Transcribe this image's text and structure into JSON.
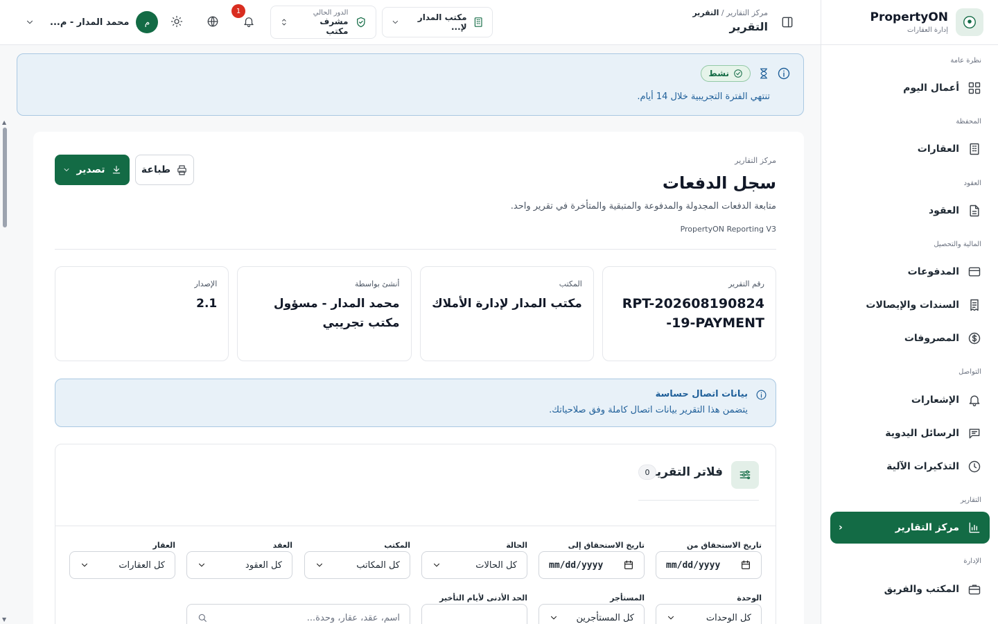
{
  "brand": {
    "name": "PropertyON",
    "subtitle": "إدارة العقارات"
  },
  "sidebar": {
    "sections": [
      {
        "title": "نظرة عامة",
        "items": [
          {
            "label": "أعمال اليوم",
            "icon": "grid-icon"
          }
        ]
      },
      {
        "title": "المحفظة",
        "items": [
          {
            "label": "العقارات",
            "icon": "building-icon"
          }
        ]
      },
      {
        "title": "العقود",
        "items": [
          {
            "label": "العقود",
            "icon": "file-icon"
          }
        ]
      },
      {
        "title": "المالية والتحصيل",
        "items": [
          {
            "label": "المدفوعات",
            "icon": "card-icon"
          },
          {
            "label": "السندات والإيصالات",
            "icon": "receipt-icon"
          },
          {
            "label": "المصروفات",
            "icon": "dollar-icon"
          }
        ]
      },
      {
        "title": "التواصل",
        "items": [
          {
            "label": "الإشعارات",
            "icon": "bell-icon"
          },
          {
            "label": "الرسائل اليدوية",
            "icon": "message-icon"
          },
          {
            "label": "التذكيرات الآلية",
            "icon": "clock-icon"
          }
        ]
      },
      {
        "title": "التقارير",
        "items": [
          {
            "label": "مركز التقارير",
            "icon": "chart-icon",
            "active": true
          }
        ]
      },
      {
        "title": "الإدارة",
        "items": [
          {
            "label": "المكتب والفريق",
            "icon": "briefcase-icon"
          }
        ]
      }
    ]
  },
  "topbar": {
    "breadcrumb_parent": "مركز التقارير",
    "breadcrumb_current": "التقرير",
    "page_title": "التقرير",
    "office_selector": "مكتب المدار لإ...",
    "role_label": "الدور الحالي",
    "role_value": "مشرف مكتب",
    "notification_count": "1",
    "user_name": "محمد المدار - م...",
    "user_initial": "م"
  },
  "trial": {
    "status": "نشط",
    "message": "تنتهي الفترة التجريبية خلال 14 أيام."
  },
  "report": {
    "crumb": "مركز التقارير",
    "title": "سجل الدفعات",
    "description": "متابعة الدفعات المجدولة والمدفوعة والمتبقية والمتأخرة في تقرير واحد.",
    "version_line": "PropertyON Reporting V3",
    "export_label": "تصدير",
    "print_label": "طباعة"
  },
  "meta_cards": [
    {
      "key": "رقم التقرير",
      "value": "RPT-20260819082419-PAYMENT-"
    },
    {
      "key": "المكتب",
      "value": "مكتب المدار لإدارة الأملاك"
    },
    {
      "key": "أنشئ بواسطة",
      "value": "محمد المدار - مسؤول مكتب تجريبي"
    },
    {
      "key": "الإصدار",
      "value": "2.1"
    }
  ],
  "sensitive": {
    "title": "بيانات اتصال حساسة",
    "description": "يتضمن هذا التقرير بيانات اتصال كاملة وفق صلاحياتك."
  },
  "filters": {
    "title": "فلاتر التقرير",
    "count": "0",
    "date_from_label": "تاريخ الاستحقاق من",
    "date_from_value": "mm/dd/yyyy",
    "date_to_label": "تاريخ الاستحقاق إلى",
    "date_to_value": "mm/dd/yyyy",
    "status_label": "الحالة",
    "status_value": "كل الحالات",
    "office_label": "المكتب",
    "office_value": "كل المكاتب",
    "contract_label": "العقد",
    "contract_value": "كل العقود",
    "property_label": "العقار",
    "property_value": "كل العقارات",
    "unit_label": "الوحدة",
    "unit_value": "كل الوحدات",
    "tenant_label": "المستأجر",
    "tenant_value": "كل المستأجرين",
    "min_delay_label": "الحد الأدنى لأيام التأخير",
    "search_placeholder": "اسم، عقد، عقار، وحدة..."
  },
  "colors": {
    "primary": "#136b45",
    "info_bg": "#e8f1f8",
    "info_text": "#1f5f99"
  }
}
